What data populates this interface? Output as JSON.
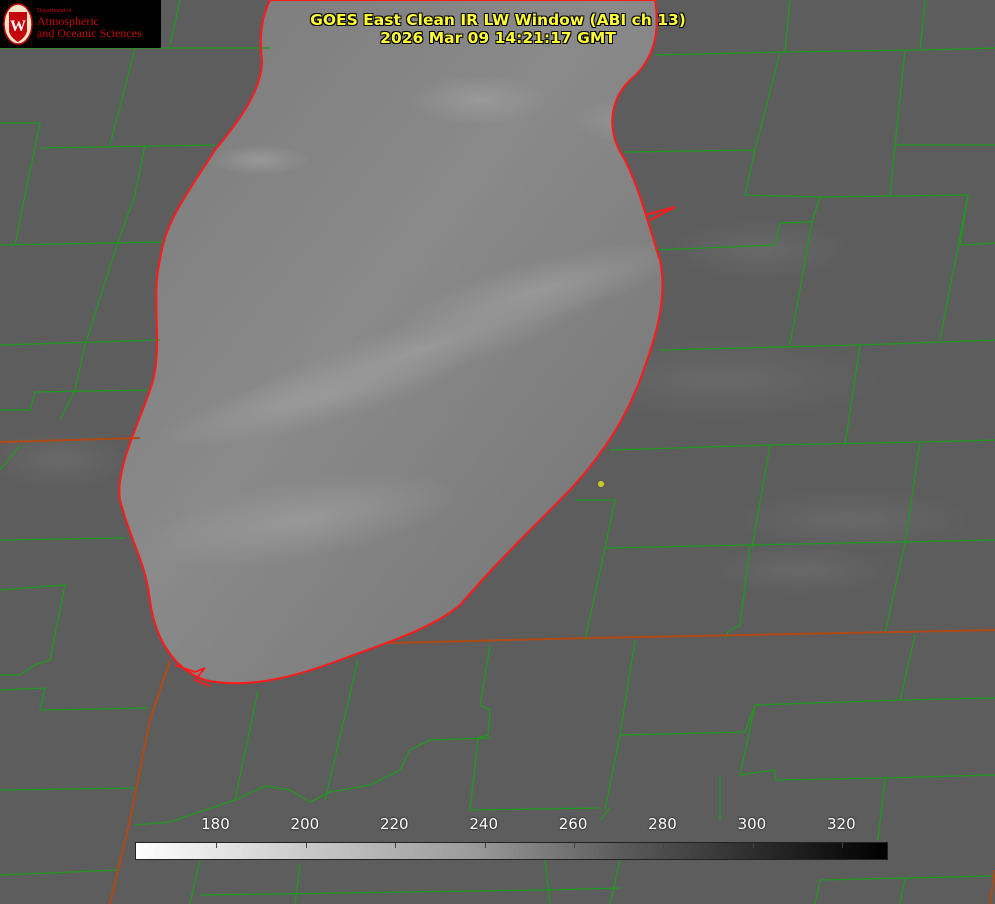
{
  "title": {
    "line1": "GOES East Clean IR LW Window (ABI ch 13)",
    "line2": "2026 Mar 09 14:21:17 GMT"
  },
  "logo": {
    "dept": "Department of",
    "line1": "Atmospheric",
    "line2": "and Oceanic Sciences",
    "seal_letter": "W",
    "seal_color": "#c5050c"
  },
  "colorbar": {
    "ticks": [
      "180",
      "200",
      "220",
      "240",
      "260",
      "280",
      "300",
      "320"
    ],
    "tick_values": [
      180,
      200,
      220,
      240,
      260,
      280,
      300,
      320
    ],
    "range": [
      162,
      330
    ],
    "scale": "white-to-black"
  },
  "colors": {
    "county_lines": "#1d9a1d",
    "state_lines": "#b04a14",
    "lake_outline": "#ff1a1a",
    "title_text": "#ffff33",
    "marker": "#cccc22",
    "land": "#5c5c5c",
    "lake": "#7c7c7c"
  },
  "icons": [
    "uw-seal-icon",
    "location-marker-icon"
  ]
}
